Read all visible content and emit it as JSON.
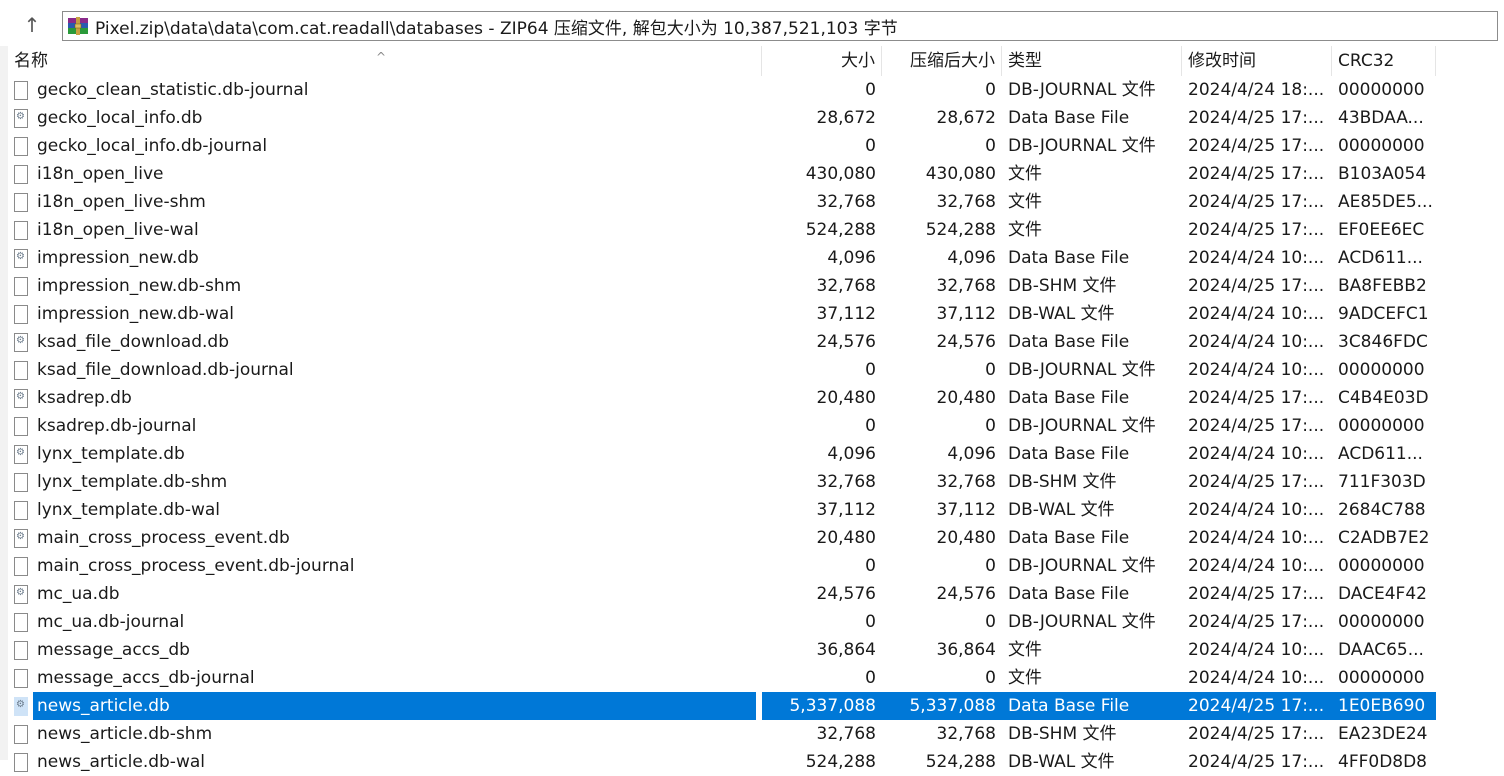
{
  "address": {
    "path_text": "Pixel.zip\\data\\data\\com.cat.readall\\databases - ZIP64 压缩文件, 解包大小为 10,387,521,103 字节"
  },
  "columns": {
    "name": "名称",
    "size": "大小",
    "compressed": "压缩后大小",
    "type": "类型",
    "modified": "修改时间",
    "crc": "CRC32"
  },
  "rows": [
    {
      "name": "gecko_clean_statistic.db-journal",
      "icon": "file-icon",
      "size": "0",
      "compressed": "0",
      "type": "DB-JOURNAL 文件",
      "modified": "2024/4/24 18:...",
      "crc": "00000000"
    },
    {
      "name": "gecko_local_info.db",
      "icon": "db-file-icon",
      "size": "28,672",
      "compressed": "28,672",
      "type": "Data Base File",
      "modified": "2024/4/25 17:...",
      "crc": "43BDAA..."
    },
    {
      "name": "gecko_local_info.db-journal",
      "icon": "file-icon",
      "size": "0",
      "compressed": "0",
      "type": "DB-JOURNAL 文件",
      "modified": "2024/4/25 17:...",
      "crc": "00000000"
    },
    {
      "name": "i18n_open_live",
      "icon": "file-icon",
      "size": "430,080",
      "compressed": "430,080",
      "type": "文件",
      "modified": "2024/4/25 17:...",
      "crc": "B103A054"
    },
    {
      "name": "i18n_open_live-shm",
      "icon": "file-icon",
      "size": "32,768",
      "compressed": "32,768",
      "type": "文件",
      "modified": "2024/4/25 17:...",
      "crc": "AE85DE5..."
    },
    {
      "name": "i18n_open_live-wal",
      "icon": "file-icon",
      "size": "524,288",
      "compressed": "524,288",
      "type": "文件",
      "modified": "2024/4/25 17:...",
      "crc": "EF0EE6EC"
    },
    {
      "name": "impression_new.db",
      "icon": "db-file-icon",
      "size": "4,096",
      "compressed": "4,096",
      "type": "Data Base File",
      "modified": "2024/4/24 10:...",
      "crc": "ACD611..."
    },
    {
      "name": "impression_new.db-shm",
      "icon": "file-icon",
      "size": "32,768",
      "compressed": "32,768",
      "type": "DB-SHM 文件",
      "modified": "2024/4/25 17:...",
      "crc": "BA8FEBB2"
    },
    {
      "name": "impression_new.db-wal",
      "icon": "file-icon",
      "size": "37,112",
      "compressed": "37,112",
      "type": "DB-WAL 文件",
      "modified": "2024/4/24 10:...",
      "crc": "9ADCEFC1"
    },
    {
      "name": "ksad_file_download.db",
      "icon": "db-file-icon",
      "size": "24,576",
      "compressed": "24,576",
      "type": "Data Base File",
      "modified": "2024/4/24 10:...",
      "crc": "3C846FDC"
    },
    {
      "name": "ksad_file_download.db-journal",
      "icon": "file-icon",
      "size": "0",
      "compressed": "0",
      "type": "DB-JOURNAL 文件",
      "modified": "2024/4/24 10:...",
      "crc": "00000000"
    },
    {
      "name": "ksadrep.db",
      "icon": "db-file-icon",
      "size": "20,480",
      "compressed": "20,480",
      "type": "Data Base File",
      "modified": "2024/4/25 17:...",
      "crc": "C4B4E03D"
    },
    {
      "name": "ksadrep.db-journal",
      "icon": "file-icon",
      "size": "0",
      "compressed": "0",
      "type": "DB-JOURNAL 文件",
      "modified": "2024/4/25 17:...",
      "crc": "00000000"
    },
    {
      "name": "lynx_template.db",
      "icon": "db-file-icon",
      "size": "4,096",
      "compressed": "4,096",
      "type": "Data Base File",
      "modified": "2024/4/24 10:...",
      "crc": "ACD611..."
    },
    {
      "name": "lynx_template.db-shm",
      "icon": "file-icon",
      "size": "32,768",
      "compressed": "32,768",
      "type": "DB-SHM 文件",
      "modified": "2024/4/25 17:...",
      "crc": "711F303D"
    },
    {
      "name": "lynx_template.db-wal",
      "icon": "file-icon",
      "size": "37,112",
      "compressed": "37,112",
      "type": "DB-WAL 文件",
      "modified": "2024/4/24 10:...",
      "crc": "2684C788"
    },
    {
      "name": "main_cross_process_event.db",
      "icon": "db-file-icon",
      "size": "20,480",
      "compressed": "20,480",
      "type": "Data Base File",
      "modified": "2024/4/24 10:...",
      "crc": "C2ADB7E2"
    },
    {
      "name": "main_cross_process_event.db-journal",
      "icon": "file-icon",
      "size": "0",
      "compressed": "0",
      "type": "DB-JOURNAL 文件",
      "modified": "2024/4/24 10:...",
      "crc": "00000000"
    },
    {
      "name": "mc_ua.db",
      "icon": "db-file-icon",
      "size": "24,576",
      "compressed": "24,576",
      "type": "Data Base File",
      "modified": "2024/4/25 17:...",
      "crc": "DACE4F42"
    },
    {
      "name": "mc_ua.db-journal",
      "icon": "file-icon",
      "size": "0",
      "compressed": "0",
      "type": "DB-JOURNAL 文件",
      "modified": "2024/4/25 17:...",
      "crc": "00000000"
    },
    {
      "name": "message_accs_db",
      "icon": "file-icon",
      "size": "36,864",
      "compressed": "36,864",
      "type": "文件",
      "modified": "2024/4/24 10:...",
      "crc": "DAAC65..."
    },
    {
      "name": "message_accs_db-journal",
      "icon": "file-icon",
      "size": "0",
      "compressed": "0",
      "type": "文件",
      "modified": "2024/4/24 10:...",
      "crc": "00000000"
    },
    {
      "name": "news_article.db",
      "icon": "db-file-icon",
      "size": "5,337,088",
      "compressed": "5,337,088",
      "type": "Data Base File",
      "modified": "2024/4/25 17:...",
      "crc": "1E0EB690",
      "selected": true
    },
    {
      "name": "news_article.db-shm",
      "icon": "file-icon",
      "size": "32,768",
      "compressed": "32,768",
      "type": "DB-SHM 文件",
      "modified": "2024/4/25 17:...",
      "crc": "EA23DE24"
    },
    {
      "name": "news_article.db-wal",
      "icon": "file-icon",
      "size": "524,288",
      "compressed": "524,288",
      "type": "DB-WAL 文件",
      "modified": "2024/4/25 17:...",
      "crc": "4FF0D8D8"
    }
  ],
  "colors": {
    "selection": "#0078d7"
  }
}
